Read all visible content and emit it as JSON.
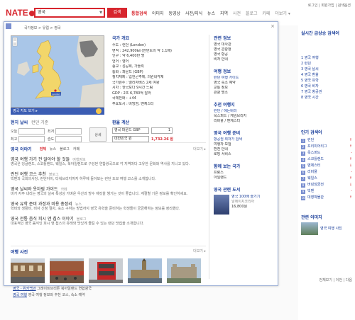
{
  "header": {
    "logo_text": "NATE",
    "search_value": "영국",
    "search_button": "검색",
    "nav": [
      "통합검색",
      "이미지",
      "동영상",
      "사전/지식",
      "뉴스",
      "지역"
    ],
    "nav_more": [
      "사전",
      "블로그",
      "카페",
      "더보기 ▾"
    ],
    "top_links": "로그인 | 회원가입 | 검색옵션"
  },
  "popup": {
    "breadcrumb": "국가정보 > 유럽 > 영국",
    "close_label": "×",
    "map_caption": "영국 지도 보기 ▸",
    "facts_title": "국가 개요",
    "facts": [
      "수도 : 런던 (London)",
      "면적 : 242,900㎢ (한반도의 약 1.1배)",
      "인구 : 약 6,400만 명",
      "언어 : 영어",
      "종교 : 성공회, 가톨릭",
      "통화 : 파운드 (GBP)",
      "정치체제 : 입헌군주제, 의원내각제",
      "국가원수 : 엘리자베스 2세 여왕",
      "시차 : 한국보다 9시간 느림",
      "GDP : 2조 6,780억 달러",
      "국제전화 : +44",
      "주요도시 : 버밍엄, 맨체스터"
    ],
    "weather": {
      "title": "현지 날씨",
      "sub": "런던 기준",
      "cells": [
        "오늘",
        "최저",
        "최고",
        "습도"
      ],
      "button": "상세"
    },
    "exchange": {
      "title": "환율 계산",
      "from": "영국 파운드 GBP",
      "from_value": "1",
      "to": "대한민국 원",
      "result": "1,732.26 원"
    },
    "news": {
      "title": "영국 이야기",
      "tabs": [
        "전체",
        "뉴스",
        "블로그",
        "카페"
      ],
      "active_tab": "전체",
      "more": "더보기 ▸",
      "items": [
        {
          "headline": "영국 여행 가기 전 알아야 할 것들",
          "source": "여행정보",
          "body": "영국은 잉글랜드, 스코틀랜드, 웨일스, 북아일랜드로 구성된 연합왕국으로 각 지역마다 고유한 문화와 역사를 지니고 있다."
        },
        {
          "headline": "런던 여행 코스 추천",
          "source": "블로그",
          "body": "빅벤과 국회의사당, 런던아이, 타워브리지까지 하루에 돌아보는 런던 도보 여행 코스를 소개합니다."
        },
        {
          "headline": "영국 날씨와 옷차림 가이드",
          "source": "카페",
          "body": "비가 자주 내리는 영국의 날씨 특성상 가벼운 우산과 방수 재킷을 챙기는 것이 좋습니다. 계절별 기온 정보를 확인하세요."
        },
        {
          "headline": "영국 유학 준비 과정과 비용 총정리",
          "source": "뉴스",
          "body": "학비와 생활비, 비자 신청 절차, 숙소 구하는 방법까지 영국 유학을 준비하는 학생들이 궁금해하는 정보를 정리했다."
        },
        {
          "headline": "영국 전통 음식 피시 앤 칩스 이야기",
          "source": "블로그",
          "body": "대표적인 영국 음식인 피시 앤 칩스의 유래와 맛있게 즐길 수 있는 런던 맛집을 소개합니다."
        }
      ]
    },
    "photos": {
      "title": "여행 사진",
      "more": "더보기 ▸",
      "items": [
        "london-street-photo",
        "market-photo",
        "double-decker-bus-photo",
        "westminster-photo",
        "tower-photo"
      ]
    },
    "side": {
      "sections": [
        {
          "title": "관련 정보",
          "lines": [
            "영국 대사관",
            "영국 관광청",
            "영국 항공",
            "비자 안내"
          ]
        },
        {
          "title": "여행 정보",
          "lines": [
            "런던 여행 가이드",
            "영국 숙소 예약",
            "교통 정보",
            "관광 명소"
          ]
        },
        {
          "title": "추천 여행지",
          "lines": [
            "런던 / 에든버러",
            "옥스퍼드 / 케임브리지",
            "리버풀 / 맨체스터"
          ]
        },
        {
          "title": "영국 여행 준비",
          "lines": [
            "항공권 최저가 검색",
            "여행자 보험",
            "환전 안내",
            "로밍 서비스"
          ]
        },
        {
          "title": "함께 보는 국가",
          "lines": [
            "프랑스",
            "아일랜드"
          ]
        },
        {
          "title": "영국 관련 도서",
          "lines": []
        }
      ],
      "book": {
        "title": "영국 100배 즐기기",
        "meta": "알에이치코리아",
        "price": "16,800원"
      }
    }
  },
  "right_rail": {
    "sec1_title": "실시간 급상승 검색어",
    "sec1_links": [
      "1 영국 여행",
      "2 런던",
      "3 영국 날씨",
      "4 영국 환율",
      "5 영국 유학",
      "6 영국 비자",
      "7 영국 항공권",
      "8 영국 시간"
    ],
    "sec2_title": "인기 검색어",
    "sec2_rows": [
      {
        "n": "1",
        "label": "런던",
        "v": "↑"
      },
      {
        "n": "2",
        "label": "프리미어리그",
        "v": "↑"
      },
      {
        "n": "3",
        "label": "옥스퍼드",
        "v": "-"
      },
      {
        "n": "4",
        "label": "스코틀랜드",
        "v": "↑"
      },
      {
        "n": "5",
        "label": "맨체스터",
        "v": "↓"
      },
      {
        "n": "6",
        "label": "리버풀",
        "v": "-"
      },
      {
        "n": "7",
        "label": "웨일스",
        "v": "↑"
      },
      {
        "n": "8",
        "label": "버킹엄궁전",
        "v": "↓"
      },
      {
        "n": "9",
        "label": "빅벤",
        "v": "-"
      },
      {
        "n": "10",
        "label": "대영박물관",
        "v": "↑"
      }
    ],
    "sec3_title": "관련 이미지",
    "sec3_link": "영국 여행 사진",
    "footer": "전체보기 | 이전 | 다음"
  },
  "results": [
    {
      "link": "영국 - 위키백과",
      "text": "그레이트브리튼 북아일랜드 연합왕국"
    },
    {
      "link": "영국 여행",
      "text": "영국 여행 정보와 추천 코스, 숙소 예약"
    }
  ],
  "colors": {
    "brand_red": "#d7262e",
    "link_blue": "#1a3e9a",
    "accent_blue": "#3b5db3"
  }
}
